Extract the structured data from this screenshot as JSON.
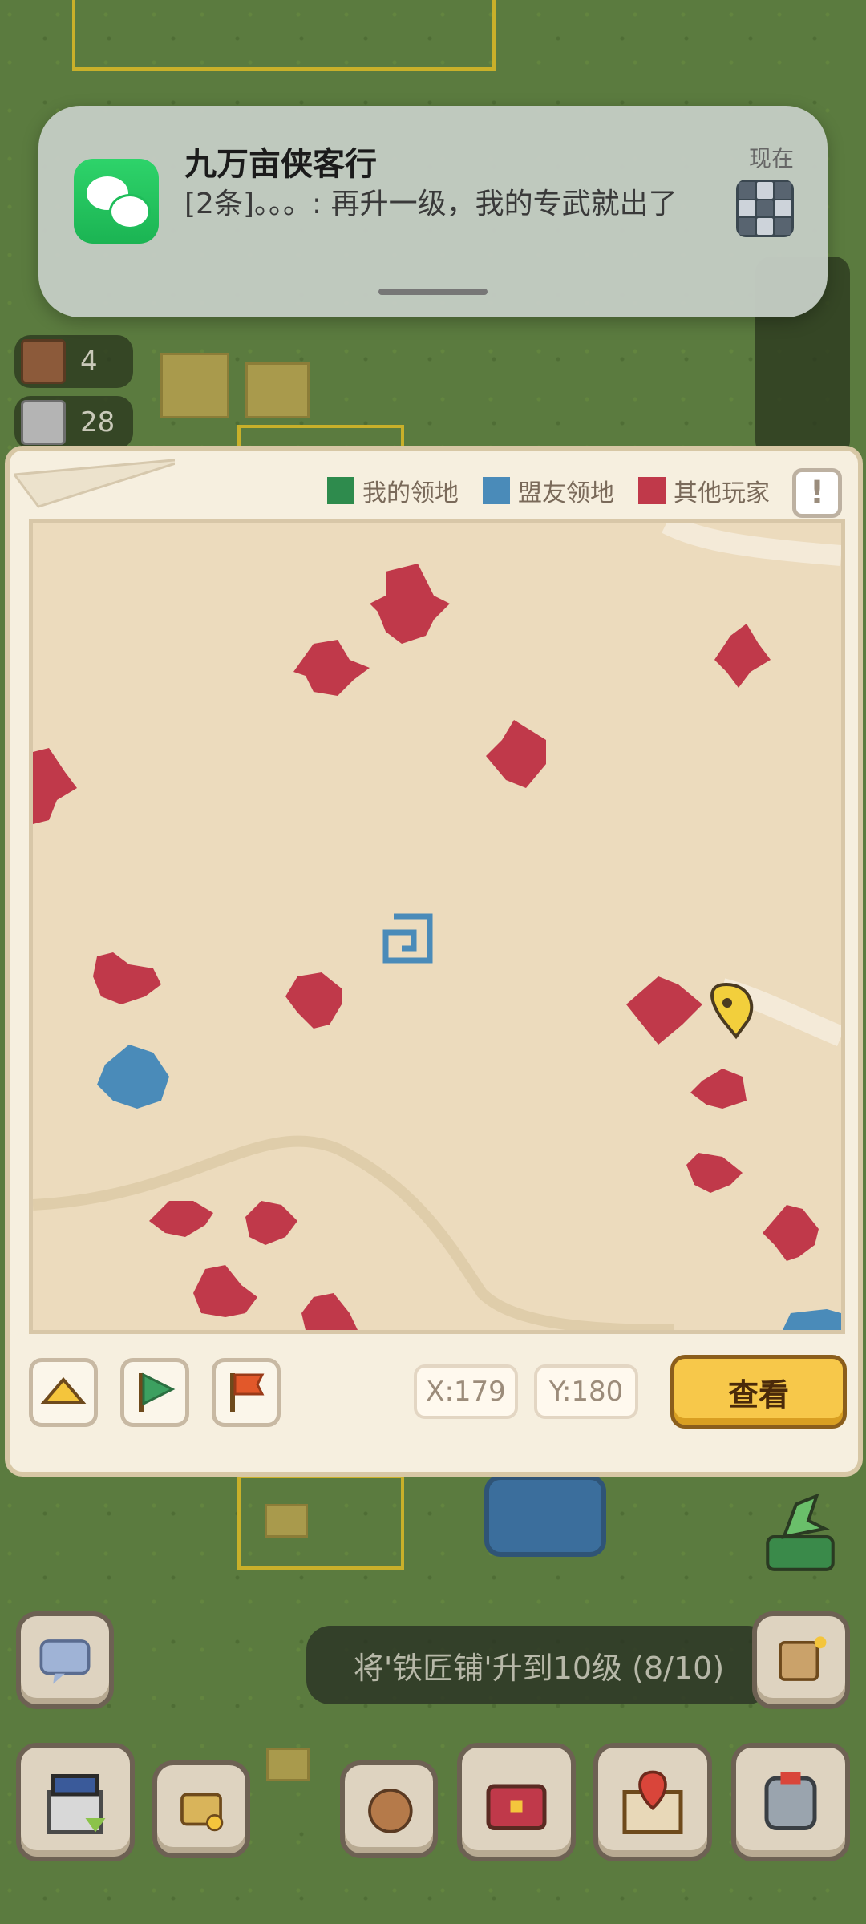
{
  "notification": {
    "app_name": "九万亩侠客行",
    "message": "[2条]。。。: 再升一级，我的专武就出了",
    "time": "现在"
  },
  "side_stats": [
    {
      "icon": "book-icon",
      "value": "4"
    },
    {
      "icon": "stone-icon",
      "value": "28"
    }
  ],
  "map_panel": {
    "legend": [
      {
        "label": "我的领地",
        "color": "#2e8b4d"
      },
      {
        "label": "盟友领地",
        "color": "#4a8bb9"
      },
      {
        "label": "其他玩家",
        "color": "#c0394a"
      }
    ],
    "info_label": "!",
    "coord_x": "X:179",
    "coord_y": "Y:180",
    "view_button": "查看",
    "tools": [
      "home-icon",
      "green-flag-icon",
      "red-flag-icon"
    ]
  },
  "quest_text": "将'铁匠铺'升到10级 (8/10)",
  "hud_buttons": [
    "chat-icon",
    "castle-icon",
    "merchant-icon",
    "bag-icon",
    "chest-icon",
    "map-icon",
    "armor-icon",
    "scroll-icon",
    "dragon-icon"
  ]
}
